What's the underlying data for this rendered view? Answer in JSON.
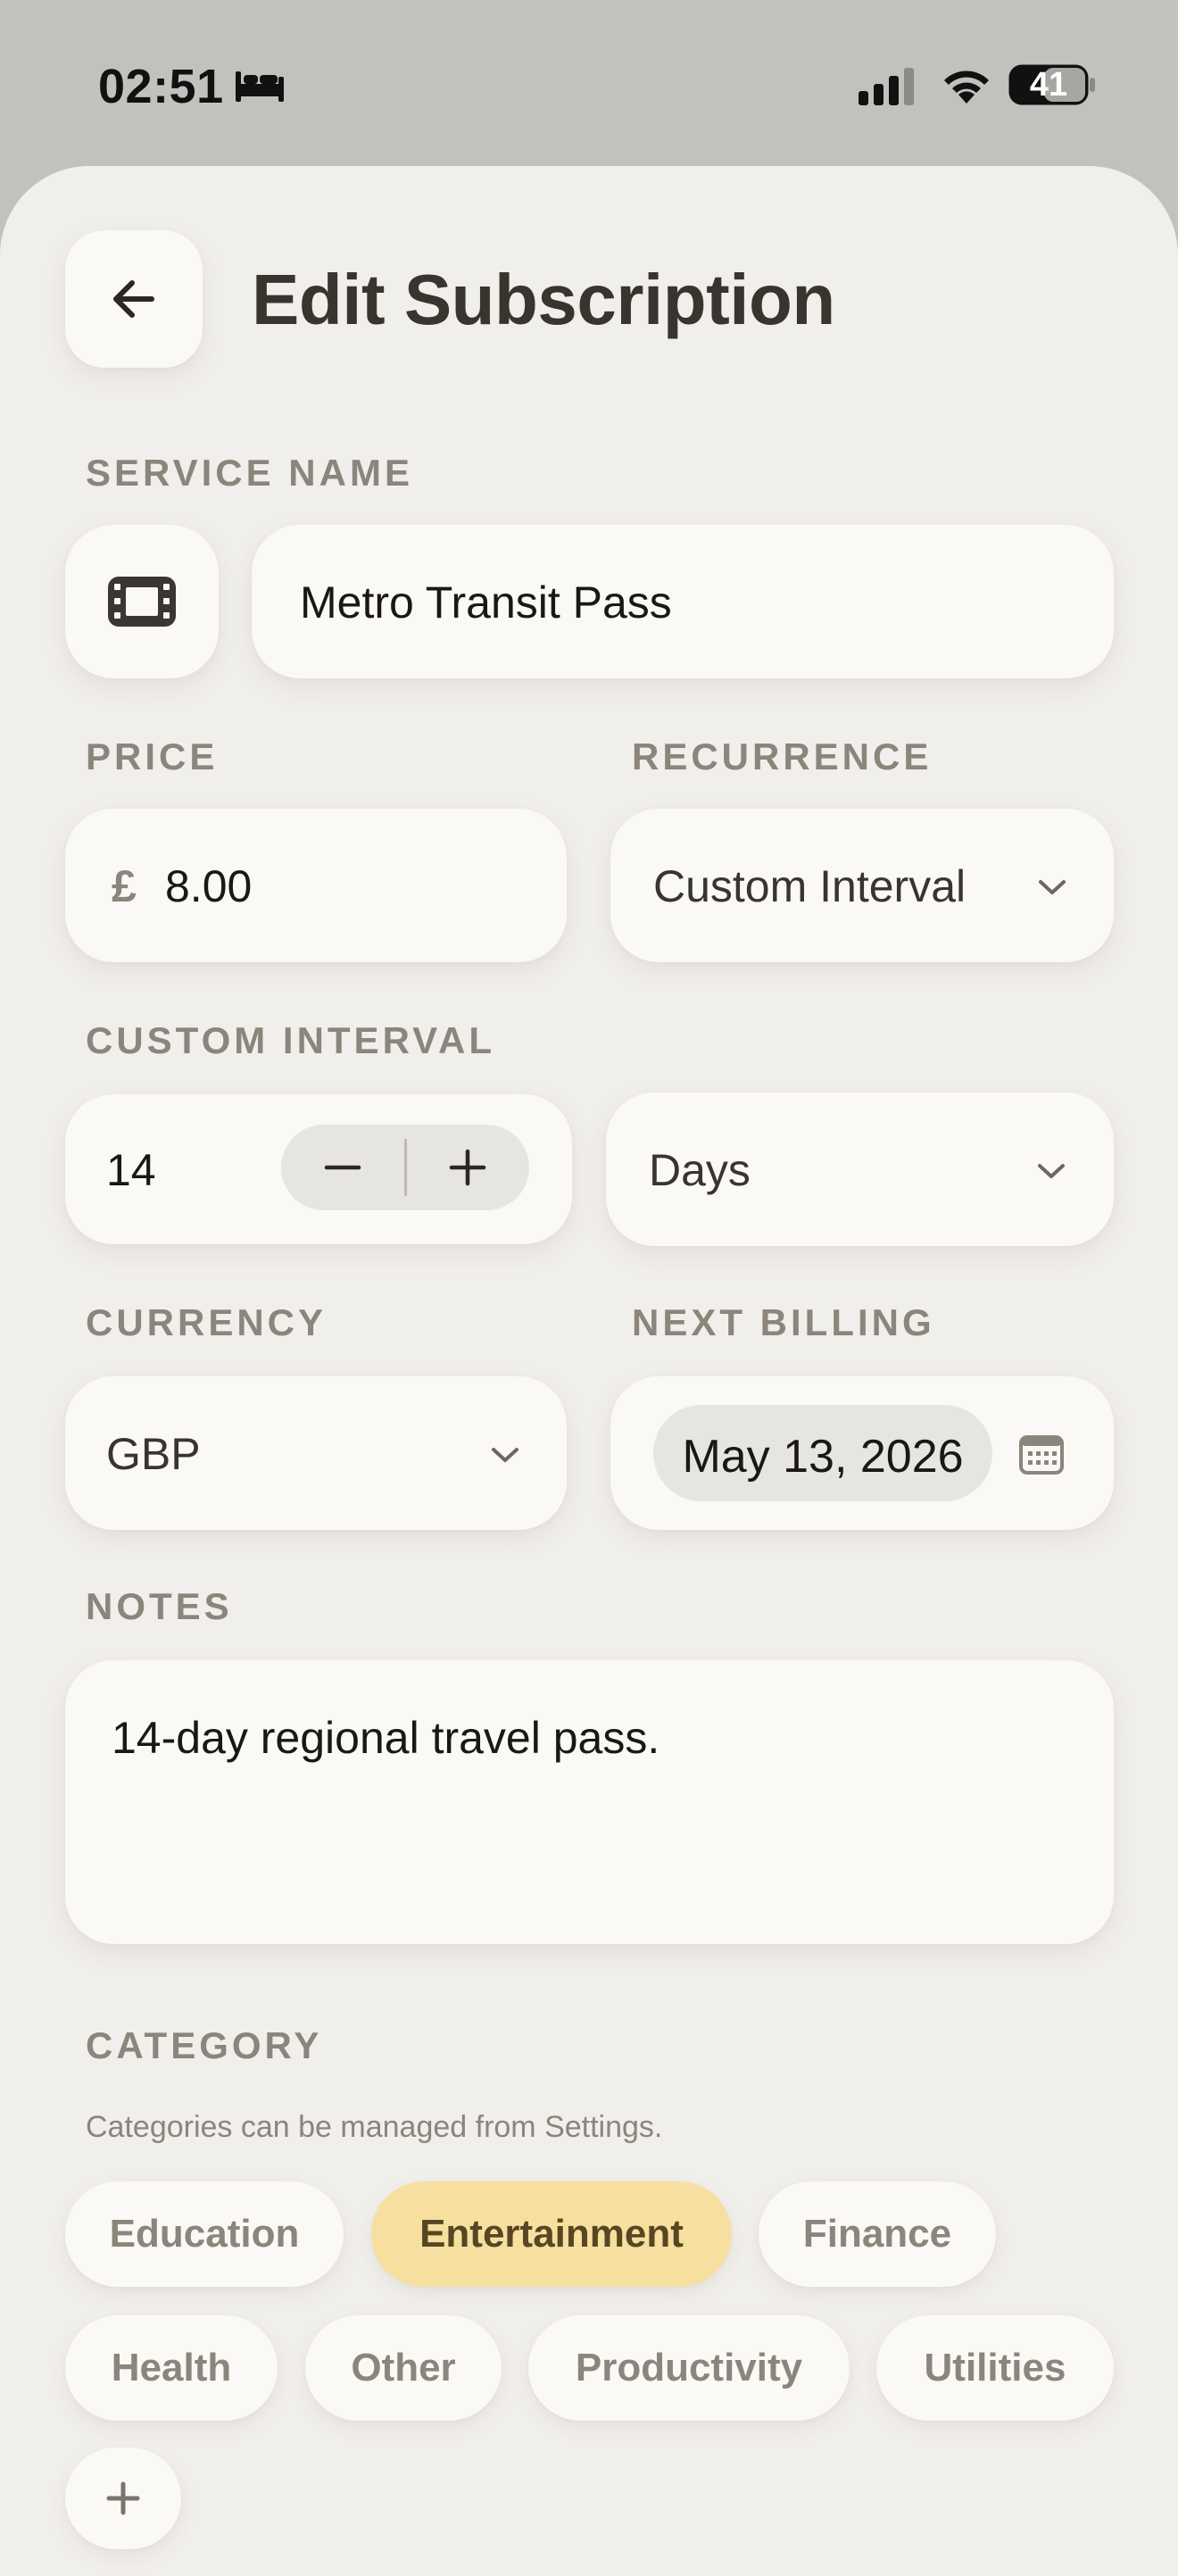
{
  "status_bar": {
    "time": "02:51",
    "battery": "41"
  },
  "header": {
    "title": "Edit Subscription"
  },
  "service": {
    "label": "SERVICE NAME",
    "value": "Metro Transit Pass",
    "icon": "film-icon"
  },
  "price": {
    "label": "PRICE",
    "symbol": "£",
    "value": "8.00"
  },
  "recurrence": {
    "label": "RECURRENCE",
    "value": "Custom Interval"
  },
  "custom_interval": {
    "label": "CUSTOM INTERVAL",
    "value": "14",
    "unit": "Days"
  },
  "currency": {
    "label": "CURRENCY",
    "value": "GBP"
  },
  "next_billing": {
    "label": "NEXT BILLING",
    "value": "May 13, 2026"
  },
  "notes": {
    "label": "NOTES",
    "value": "14-day regional travel pass."
  },
  "category": {
    "label": "CATEGORY",
    "help": "Categories can be managed from Settings.",
    "selected": "Entertainment",
    "items": [
      "Education",
      "Entertainment",
      "Finance",
      "Health",
      "Other",
      "Productivity",
      "Utilities"
    ]
  },
  "colors": {
    "background": "#f1efeb",
    "field": "#faf9f6",
    "label": "#8b857b",
    "selected_chip": "#f7dfa0",
    "title": "#38352f"
  }
}
